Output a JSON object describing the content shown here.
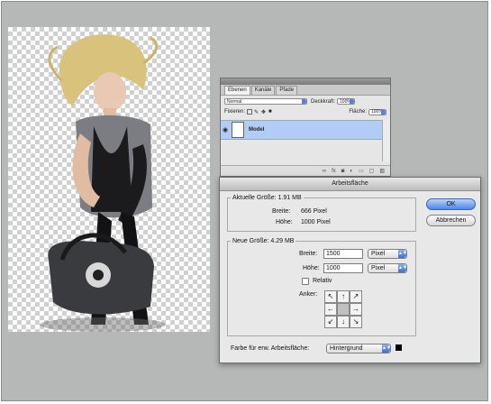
{
  "layers_panel": {
    "tabs": [
      "Ebenen",
      "Kanäle",
      "Pfade"
    ],
    "blend_mode": "Normal",
    "opacity_label": "Deckkraft:",
    "opacity_value": "100%",
    "lock_label": "Fixieren:",
    "fill_label": "Fläche:",
    "fill_value": "100%",
    "layer_name": "Model"
  },
  "dialog": {
    "title": "Arbeitsfläche",
    "current_size": {
      "label": "Aktuelle Größe: 1.91 MB",
      "width_label": "Breite:",
      "width_value": "666 Pixel",
      "height_label": "Höhe:",
      "height_value": "1000 Pixel"
    },
    "new_size": {
      "label": "Neue Größe: 4.29 MB",
      "width_label": "Breite:",
      "width_value": "1500",
      "width_unit": "Pixel",
      "height_label": "Höhe:",
      "height_value": "1000",
      "height_unit": "Pixel",
      "relative_label": "Relativ",
      "anchor_label": "Anker:"
    },
    "extension_color_label": "Farbe für erw. Arbeitsfläche:",
    "extension_color_value": "Hintergrund",
    "ok_label": "OK",
    "cancel_label": "Abbrechen"
  }
}
